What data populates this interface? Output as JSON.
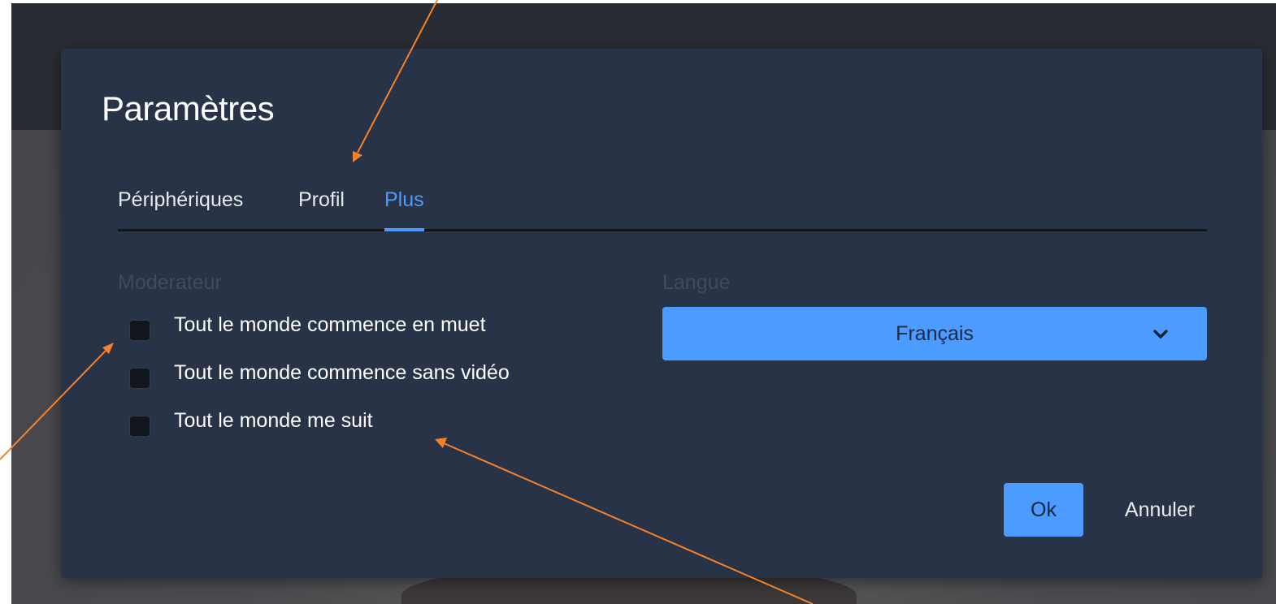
{
  "dialog": {
    "title": "Paramètres",
    "tabs": [
      {
        "label": "Périphériques",
        "active": false
      },
      {
        "label": "Profil",
        "active": false
      },
      {
        "label": "Plus",
        "active": true
      }
    ],
    "moderator": {
      "label": "Moderateur",
      "options": [
        {
          "label": "Tout le monde commence en muet",
          "checked": false
        },
        {
          "label": "Tout le monde commence sans vidéo",
          "checked": false
        },
        {
          "label": "Tout le monde me suit",
          "checked": false
        }
      ]
    },
    "language": {
      "label": "Langue",
      "selected": "Français"
    },
    "buttons": {
      "ok": "Ok",
      "cancel": "Annuler"
    }
  },
  "colors": {
    "accent": "#4c9bff",
    "dialog_bg": "#283347",
    "annotation_arrow": "#f5822b"
  }
}
